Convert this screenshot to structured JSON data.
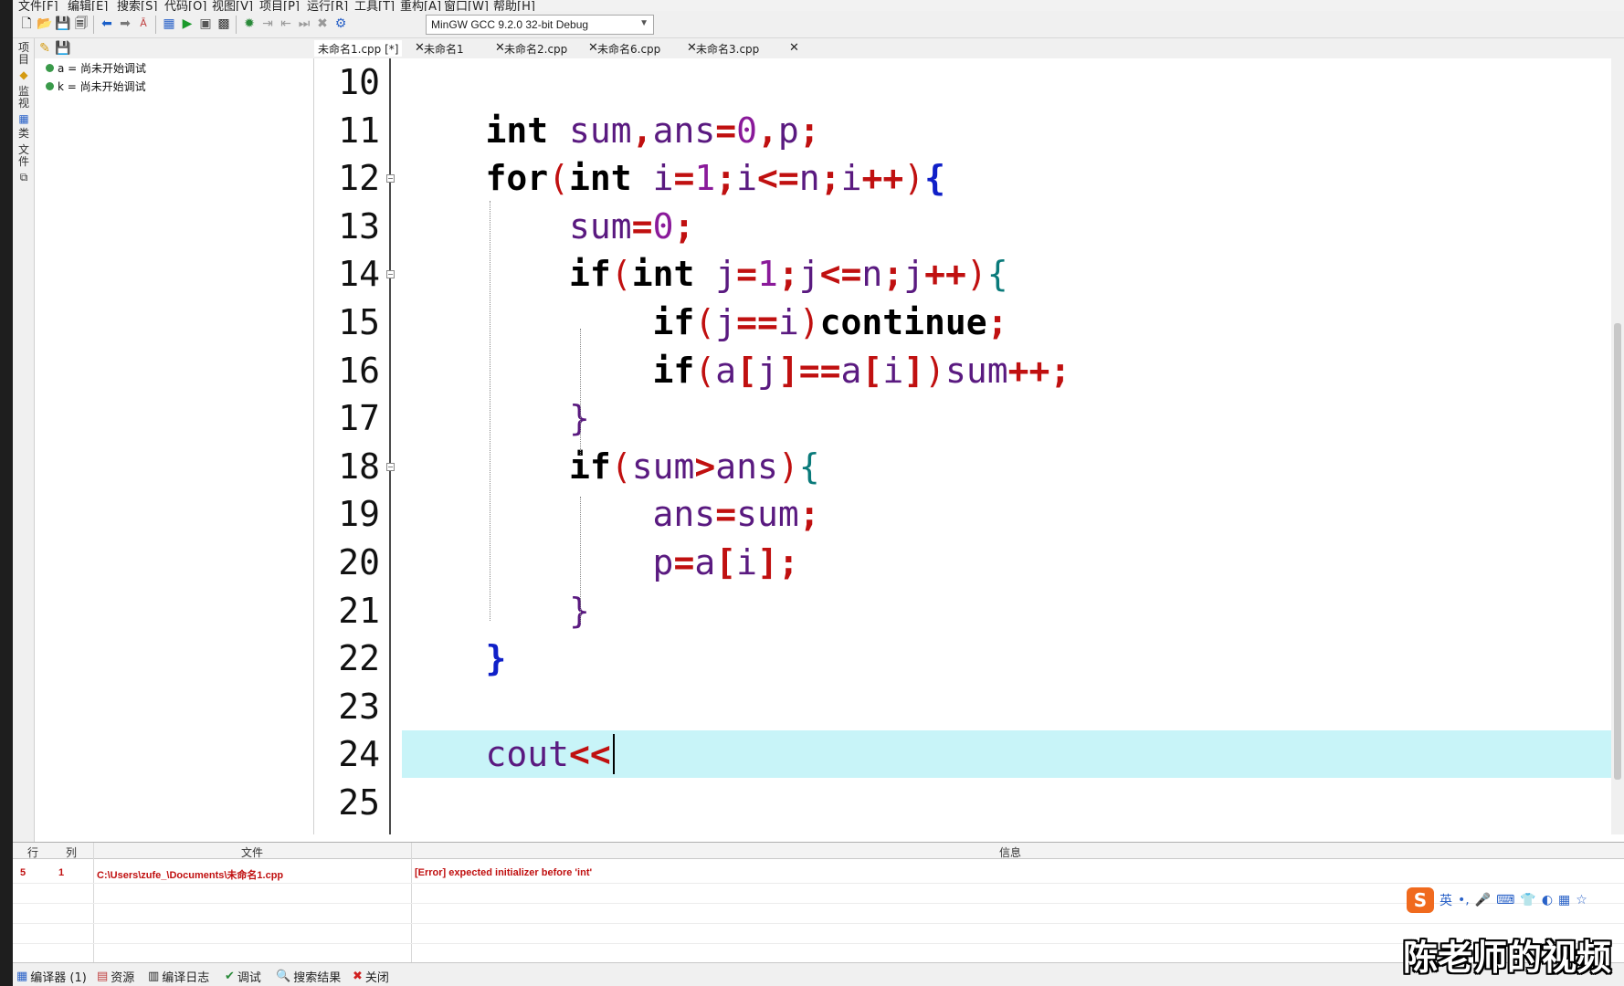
{
  "menu": [
    "文件[F]",
    "编辑[E]",
    "搜索[S]",
    "代码[O]",
    "视图[V]",
    "项目[P]",
    "运行[R]",
    "工具[T]",
    "重构[A]",
    "窗口[W]",
    "帮助[H]"
  ],
  "toolbar": {
    "icons": [
      "new-file-icon",
      "open-file-icon",
      "save-icon",
      "save-all-icon",
      "back-arrow-icon",
      "forward-arrow-icon",
      "format-icon",
      "compile-icon",
      "run-icon",
      "compile-run-icon",
      "rebuild-icon",
      "debug-icon",
      "indent-icon",
      "unindent-icon",
      "next-icon",
      "stop-icon",
      "profile-icon"
    ],
    "compiler": "MinGW GCC 9.2.0 32-bit Debug"
  },
  "vertical_tabs": [
    "项目",
    "监视",
    "类",
    "文件"
  ],
  "watch": {
    "items": [
      "a = 尚未开始调试",
      "k = 尚未开始调试"
    ]
  },
  "tabs": [
    {
      "label": "未命名1.cpp [*]",
      "active": true
    },
    {
      "label": "未命名1",
      "active": false
    },
    {
      "label": "未命名2.cpp",
      "active": false
    },
    {
      "label": "未命名6.cpp",
      "active": false
    },
    {
      "label": "未命名3.cpp",
      "active": false
    }
  ],
  "tab_close": "✕",
  "editor": {
    "line_numbers": [
      "10",
      "11",
      "12",
      "13",
      "14",
      "15",
      "16",
      "17",
      "18",
      "19",
      "20",
      "21",
      "22",
      "23",
      "24",
      "25"
    ],
    "lines": [
      {
        "line": "10",
        "tokens": []
      },
      {
        "line": "11",
        "tokens": [
          {
            "t": "    ",
            "c": "id"
          },
          {
            "t": "int",
            "c": "kw"
          },
          {
            "t": " sum",
            "c": "id"
          },
          {
            "t": ",",
            "c": "op"
          },
          {
            "t": "ans",
            "c": "id"
          },
          {
            "t": "=",
            "c": "op"
          },
          {
            "t": "0",
            "c": "num"
          },
          {
            "t": ",",
            "c": "op"
          },
          {
            "t": "p",
            "c": "id"
          },
          {
            "t": ";",
            "c": "op"
          }
        ]
      },
      {
        "line": "12",
        "tokens": [
          {
            "t": "    ",
            "c": "id"
          },
          {
            "t": "for",
            "c": "kw"
          },
          {
            "t": "(",
            "c": "br-red"
          },
          {
            "t": "int",
            "c": "kw"
          },
          {
            "t": " i",
            "c": "id"
          },
          {
            "t": "=",
            "c": "op"
          },
          {
            "t": "1",
            "c": "num"
          },
          {
            "t": ";",
            "c": "op"
          },
          {
            "t": "i",
            "c": "id"
          },
          {
            "t": "<=",
            "c": "op"
          },
          {
            "t": "n",
            "c": "id"
          },
          {
            "t": ";",
            "c": "op"
          },
          {
            "t": "i",
            "c": "id"
          },
          {
            "t": "++",
            "c": "op"
          },
          {
            "t": ")",
            "c": "br-red"
          },
          {
            "t": "{",
            "c": "br-blue"
          }
        ]
      },
      {
        "line": "13",
        "tokens": [
          {
            "t": "        ",
            "c": "id"
          },
          {
            "t": "sum",
            "c": "id"
          },
          {
            "t": "=",
            "c": "op"
          },
          {
            "t": "0",
            "c": "num"
          },
          {
            "t": ";",
            "c": "op"
          }
        ]
      },
      {
        "line": "14",
        "tokens": [
          {
            "t": "        ",
            "c": "id"
          },
          {
            "t": "if",
            "c": "kw"
          },
          {
            "t": "(",
            "c": "br-red"
          },
          {
            "t": "int",
            "c": "kw"
          },
          {
            "t": " j",
            "c": "id"
          },
          {
            "t": "=",
            "c": "op"
          },
          {
            "t": "1",
            "c": "num"
          },
          {
            "t": ";",
            "c": "op"
          },
          {
            "t": "j",
            "c": "id"
          },
          {
            "t": "<=",
            "c": "op"
          },
          {
            "t": "n",
            "c": "id"
          },
          {
            "t": ";",
            "c": "op"
          },
          {
            "t": "j",
            "c": "id"
          },
          {
            "t": "++",
            "c": "op"
          },
          {
            "t": ")",
            "c": "br-red"
          },
          {
            "t": "{",
            "c": "br-teal"
          }
        ]
      },
      {
        "line": "15",
        "tokens": [
          {
            "t": "            ",
            "c": "id"
          },
          {
            "t": "if",
            "c": "kw"
          },
          {
            "t": "(",
            "c": "br-red"
          },
          {
            "t": "j",
            "c": "id"
          },
          {
            "t": "==",
            "c": "op"
          },
          {
            "t": "i",
            "c": "id"
          },
          {
            "t": ")",
            "c": "br-red"
          },
          {
            "t": "continue",
            "c": "kw"
          },
          {
            "t": ";",
            "c": "op"
          }
        ]
      },
      {
        "line": "16",
        "tokens": [
          {
            "t": "            ",
            "c": "id"
          },
          {
            "t": "if",
            "c": "kw"
          },
          {
            "t": "(",
            "c": "br-red"
          },
          {
            "t": "a",
            "c": "id"
          },
          {
            "t": "[",
            "c": "op"
          },
          {
            "t": "j",
            "c": "id"
          },
          {
            "t": "]",
            "c": "op"
          },
          {
            "t": "==",
            "c": "op"
          },
          {
            "t": "a",
            "c": "id"
          },
          {
            "t": "[",
            "c": "op"
          },
          {
            "t": "i",
            "c": "id"
          },
          {
            "t": "]",
            "c": "op"
          },
          {
            "t": ")",
            "c": "br-red"
          },
          {
            "t": "sum",
            "c": "id"
          },
          {
            "t": "++",
            "c": "op"
          },
          {
            "t": ";",
            "c": "op"
          }
        ]
      },
      {
        "line": "17",
        "tokens": [
          {
            "t": "        ",
            "c": "id"
          },
          {
            "t": "}",
            "c": "br-purple"
          }
        ]
      },
      {
        "line": "18",
        "tokens": [
          {
            "t": "        ",
            "c": "id"
          },
          {
            "t": "if",
            "c": "kw"
          },
          {
            "t": "(",
            "c": "br-red"
          },
          {
            "t": "sum",
            "c": "id"
          },
          {
            "t": ">",
            "c": "op"
          },
          {
            "t": "ans",
            "c": "id"
          },
          {
            "t": ")",
            "c": "br-red"
          },
          {
            "t": "{",
            "c": "br-teal"
          }
        ]
      },
      {
        "line": "19",
        "tokens": [
          {
            "t": "            ",
            "c": "id"
          },
          {
            "t": "ans",
            "c": "id"
          },
          {
            "t": "=",
            "c": "op"
          },
          {
            "t": "sum",
            "c": "id"
          },
          {
            "t": ";",
            "c": "op"
          }
        ]
      },
      {
        "line": "20",
        "tokens": [
          {
            "t": "            ",
            "c": "id"
          },
          {
            "t": "p",
            "c": "id"
          },
          {
            "t": "=",
            "c": "op"
          },
          {
            "t": "a",
            "c": "id"
          },
          {
            "t": "[",
            "c": "op"
          },
          {
            "t": "i",
            "c": "id"
          },
          {
            "t": "]",
            "c": "op"
          },
          {
            "t": ";",
            "c": "op"
          }
        ]
      },
      {
        "line": "21",
        "tokens": [
          {
            "t": "        ",
            "c": "id"
          },
          {
            "t": "}",
            "c": "br-purple"
          }
        ]
      },
      {
        "line": "22",
        "tokens": [
          {
            "t": "    ",
            "c": "id"
          },
          {
            "t": "}",
            "c": "br-blue"
          }
        ]
      },
      {
        "line": "23",
        "tokens": []
      },
      {
        "line": "24",
        "tokens": [
          {
            "t": "    ",
            "c": "id"
          },
          {
            "t": "cout",
            "c": "id"
          },
          {
            "t": "<<",
            "c": "op"
          }
        ]
      },
      {
        "line": "25",
        "tokens": []
      }
    ],
    "current_line_color": "#c8f4f8"
  },
  "messages": {
    "columns": [
      "行",
      "列",
      "文件",
      "信息"
    ],
    "rows": [
      {
        "line": "5",
        "col": "1",
        "file": "C:\\Users\\zufe_\\Documents\\未命名1.cpp",
        "message": "[Error] expected initializer before 'int'"
      }
    ],
    "error_color": "#c01010"
  },
  "bottom_tabs": [
    "编译器 (1)",
    "资源",
    "编译日志",
    "调试",
    "搜索结果",
    "关闭"
  ],
  "ime": {
    "lang": "英",
    "items": [
      "•,",
      "🎤",
      "⌨",
      "👕",
      "◐",
      "▦",
      "☆"
    ]
  },
  "watermark": "陈老师的视频"
}
